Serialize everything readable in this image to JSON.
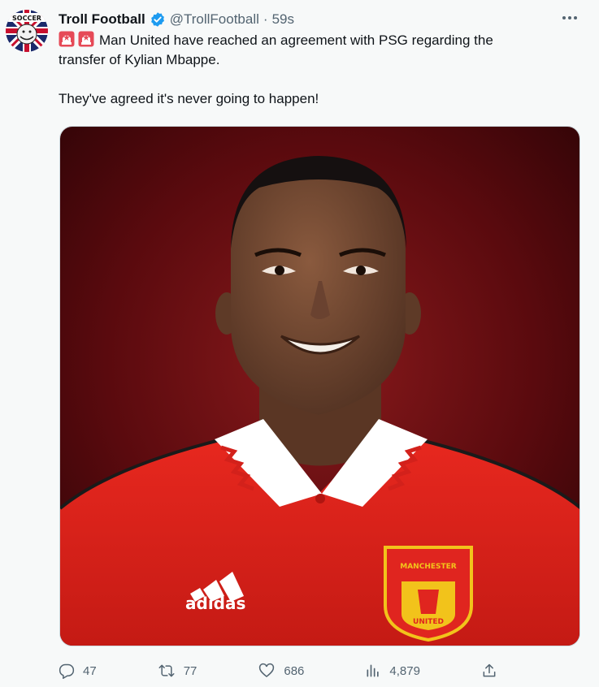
{
  "tweet": {
    "display_name": "Troll Football",
    "handle": "@TrollFootball",
    "separator": "·",
    "time": "59s",
    "text_line1": "Man United have reached an agreement with PSG regarding the",
    "text_line2": "transfer of Kylian Mbappe.",
    "text_line3": "They've agreed it's never going to happen!",
    "avatar_text": "SOCCER",
    "media": {
      "kit_brand": "adidas",
      "crest_top": "MANCHESTER",
      "crest_bottom": "UNITED"
    }
  },
  "actions": {
    "replies": "47",
    "retweets": "77",
    "likes": "686",
    "views": "4,879"
  },
  "icons": {
    "verified": "verified-badge-icon",
    "more": "more-options-icon",
    "siren": "police-siren-emoji",
    "reply": "reply-icon",
    "retweet": "retweet-icon",
    "like": "heart-icon",
    "views": "views-chart-icon",
    "share": "share-icon"
  },
  "colors": {
    "background": "#f7f9f9",
    "verified_blue": "#1d9bf0",
    "secondary_text": "#536471",
    "kit_red": "#e0251f",
    "backdrop": "#5a0a0e"
  }
}
